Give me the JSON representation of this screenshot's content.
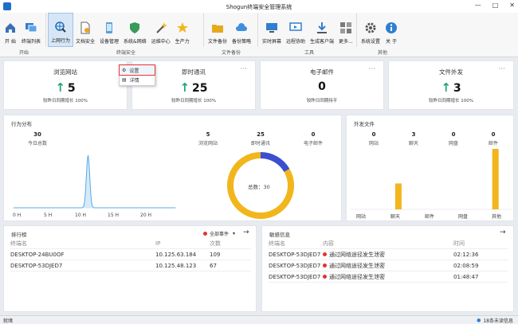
{
  "window": {
    "title": "Shogun终端安全管理系统",
    "minimize": "—",
    "maximize": "□",
    "close": "✕"
  },
  "ribbon": {
    "buttons": [
      {
        "label": "开 始",
        "icon": "home-icon"
      },
      {
        "label": "终端列表",
        "icon": "monitor-list-icon"
      },
      {
        "label": "上网行为",
        "icon": "web-behavior-icon"
      },
      {
        "label": "文档安全",
        "icon": "document-icon"
      },
      {
        "label": "设备管理",
        "icon": "device-icon"
      },
      {
        "label": "系统&网络",
        "icon": "shield-icon"
      },
      {
        "label": "运维中心",
        "icon": "wand-icon"
      },
      {
        "label": "生产力",
        "icon": "star-icon"
      },
      {
        "label": "文件备份",
        "icon": "folder-icon"
      },
      {
        "label": "备份策略",
        "icon": "cloud-icon"
      },
      {
        "label": "实时屏幕",
        "icon": "screen-icon"
      },
      {
        "label": "远程协助",
        "icon": "remote-icon"
      },
      {
        "label": "生成客户端",
        "icon": "download-icon"
      },
      {
        "label": "更多...",
        "icon": "more-icon"
      },
      {
        "label": "系统设置",
        "icon": "gear-icon"
      },
      {
        "label": "关 于",
        "icon": "info-icon"
      }
    ],
    "groups": [
      "开始",
      "终端安全",
      "文件备份",
      "工具",
      "其他"
    ]
  },
  "stats": [
    {
      "title": "浏览网站",
      "value": "5",
      "trend": "up",
      "foot": "较昨日同期增长 100%"
    },
    {
      "title": "即时通讯",
      "value": "25",
      "trend": "up",
      "foot": "较昨日同期增长 100%"
    },
    {
      "title": "电子邮件",
      "value": "0",
      "trend": "none",
      "foot": "较昨日同期持平"
    },
    {
      "title": "文件外发",
      "value": "3",
      "trend": "up",
      "foot": "较昨日同期增长 100%"
    }
  ],
  "context_menu": {
    "settings": "设置",
    "details": "详情"
  },
  "behavior": {
    "title": "行为分布",
    "total_value": "30",
    "total_label": "今日总数",
    "items": [
      {
        "label": "浏览网站",
        "value": "5"
      },
      {
        "label": "即时通讯",
        "value": "25"
      },
      {
        "label": "电子邮件",
        "value": "0"
      }
    ],
    "xticks": [
      "0 H",
      "5 H",
      "10 H",
      "15 H",
      "20 H"
    ],
    "donut_label": "总数：30"
  },
  "outgoing": {
    "title": "外发文件",
    "items": [
      {
        "label": "网站",
        "value": "0"
      },
      {
        "label": "聊天",
        "value": "3"
      },
      {
        "label": "网盘",
        "value": "0"
      },
      {
        "label": "邮件",
        "value": "0"
      }
    ],
    "bar_categories": [
      "网站",
      "聊天",
      "邮件",
      "网盘",
      "其他"
    ]
  },
  "chart_data": [
    {
      "type": "area",
      "x": [
        0,
        5,
        10,
        15,
        20
      ],
      "xlabel": "",
      "ylabel": "",
      "note_peak_hour": 11,
      "values": [
        0,
        0,
        30,
        0,
        0
      ]
    },
    {
      "type": "pie",
      "categories": [
        "浏览网站",
        "即时通讯",
        "电子邮件"
      ],
      "values": [
        5,
        25,
        0
      ]
    },
    {
      "type": "bar",
      "categories": [
        "网站",
        "聊天",
        "邮件",
        "网盘",
        "其他"
      ],
      "values": [
        0,
        3,
        0,
        0,
        7
      ]
    }
  ],
  "ranking": {
    "title": "排行榜",
    "filter": "全部事件",
    "cols": [
      "终端名",
      "IP",
      "次数"
    ],
    "rows": [
      {
        "name": "DESKTOP-24BU0OF",
        "ip": "10.125.63.184",
        "count": "109"
      },
      {
        "name": "DESKTOP-53DJED7",
        "ip": "10.125.48.123",
        "count": "67"
      }
    ]
  },
  "sensitive": {
    "title": "敏感信息",
    "cols": [
      "终端名",
      "内容",
      "时间"
    ],
    "rows": [
      {
        "name": "DESKTOP-53DJED7",
        "content": "通过网络途径发生泄密",
        "time": "02:12:36"
      },
      {
        "name": "DESKTOP-53DJED7",
        "content": "通过网络途径发生泄密",
        "time": "02:08:59"
      },
      {
        "name": "DESKTOP-53DJED7",
        "content": "通过网络途径发生泄密",
        "time": "01:48:47"
      }
    ]
  },
  "statusbar": {
    "left": "就绪",
    "right": "18条未读信息"
  }
}
